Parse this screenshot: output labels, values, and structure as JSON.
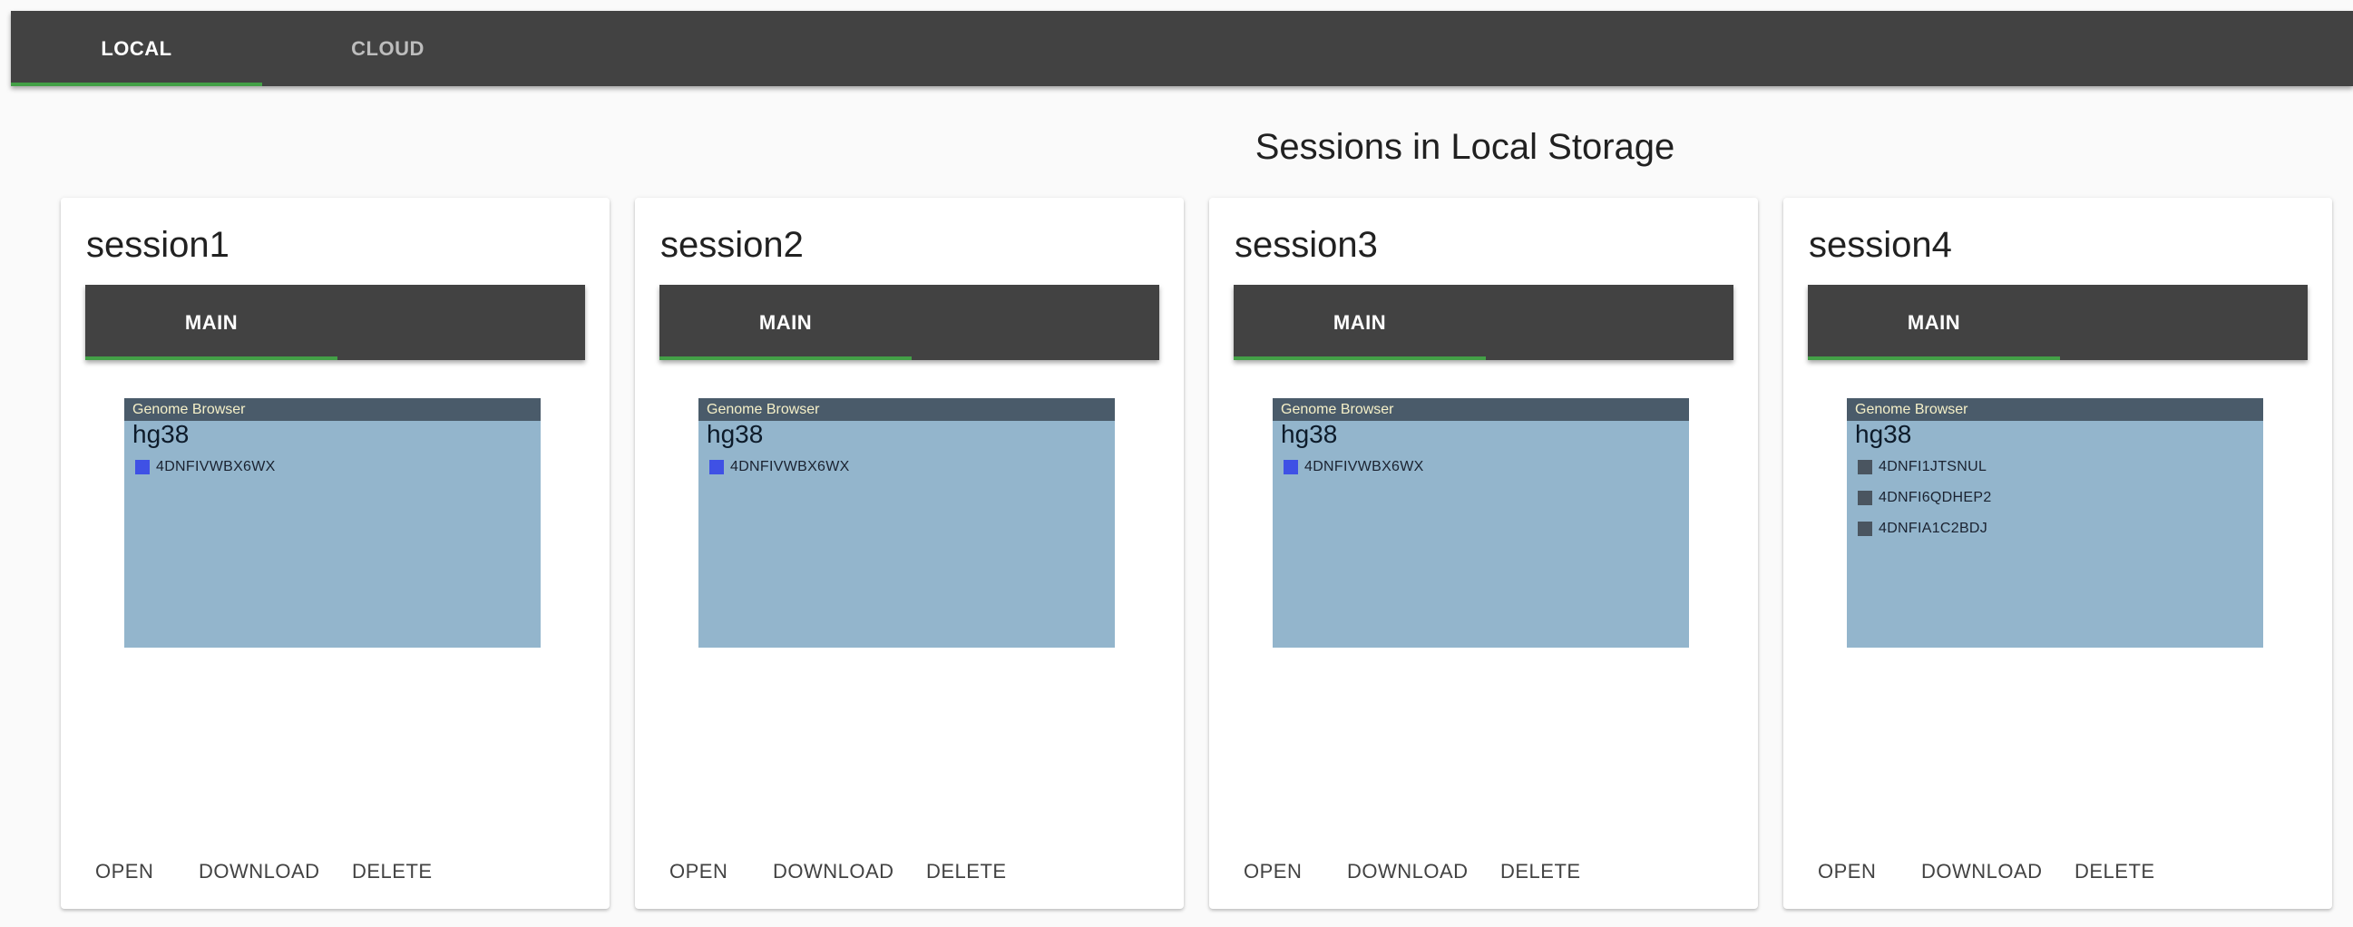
{
  "app_tabs": [
    {
      "label": "LOCAL",
      "active": true
    },
    {
      "label": "CLOUD",
      "active": false
    }
  ],
  "page": {
    "title": "Sessions in Local Storage"
  },
  "colors": {
    "appbar": "#424242",
    "tab_indicator": "#43a047",
    "browser_bg": "#93b5cc",
    "browser_header": "#4a5b6a",
    "track_blue": "#3f51e5",
    "track_gray": "#4a5560"
  },
  "sessions": [
    {
      "name": "session1",
      "view_tab": "MAIN",
      "browser": {
        "header": "Genome Browser",
        "assembly": "hg38",
        "tracks": [
          {
            "label": "4DNFIVWBX6WX",
            "color": "#3f51e5"
          }
        ]
      },
      "actions": {
        "open": "OPEN",
        "download": "DOWNLOAD",
        "delete": "DELETE"
      }
    },
    {
      "name": "session2",
      "view_tab": "MAIN",
      "browser": {
        "header": "Genome Browser",
        "assembly": "hg38",
        "tracks": [
          {
            "label": "4DNFIVWBX6WX",
            "color": "#3f51e5"
          }
        ]
      },
      "actions": {
        "open": "OPEN",
        "download": "DOWNLOAD",
        "delete": "DELETE"
      }
    },
    {
      "name": "session3",
      "view_tab": "MAIN",
      "browser": {
        "header": "Genome Browser",
        "assembly": "hg38",
        "tracks": [
          {
            "label": "4DNFIVWBX6WX",
            "color": "#3f51e5"
          }
        ]
      },
      "actions": {
        "open": "OPEN",
        "download": "DOWNLOAD",
        "delete": "DELETE"
      }
    },
    {
      "name": "session4",
      "view_tab": "MAIN",
      "browser": {
        "header": "Genome Browser",
        "assembly": "hg38",
        "tracks": [
          {
            "label": "4DNFI1JTSNUL",
            "color": "#4a5560"
          },
          {
            "label": "4DNFI6QDHEP2",
            "color": "#4a5560"
          },
          {
            "label": "4DNFIA1C2BDJ",
            "color": "#4a5560"
          }
        ]
      },
      "actions": {
        "open": "OPEN",
        "download": "DOWNLOAD",
        "delete": "DELETE"
      }
    }
  ]
}
